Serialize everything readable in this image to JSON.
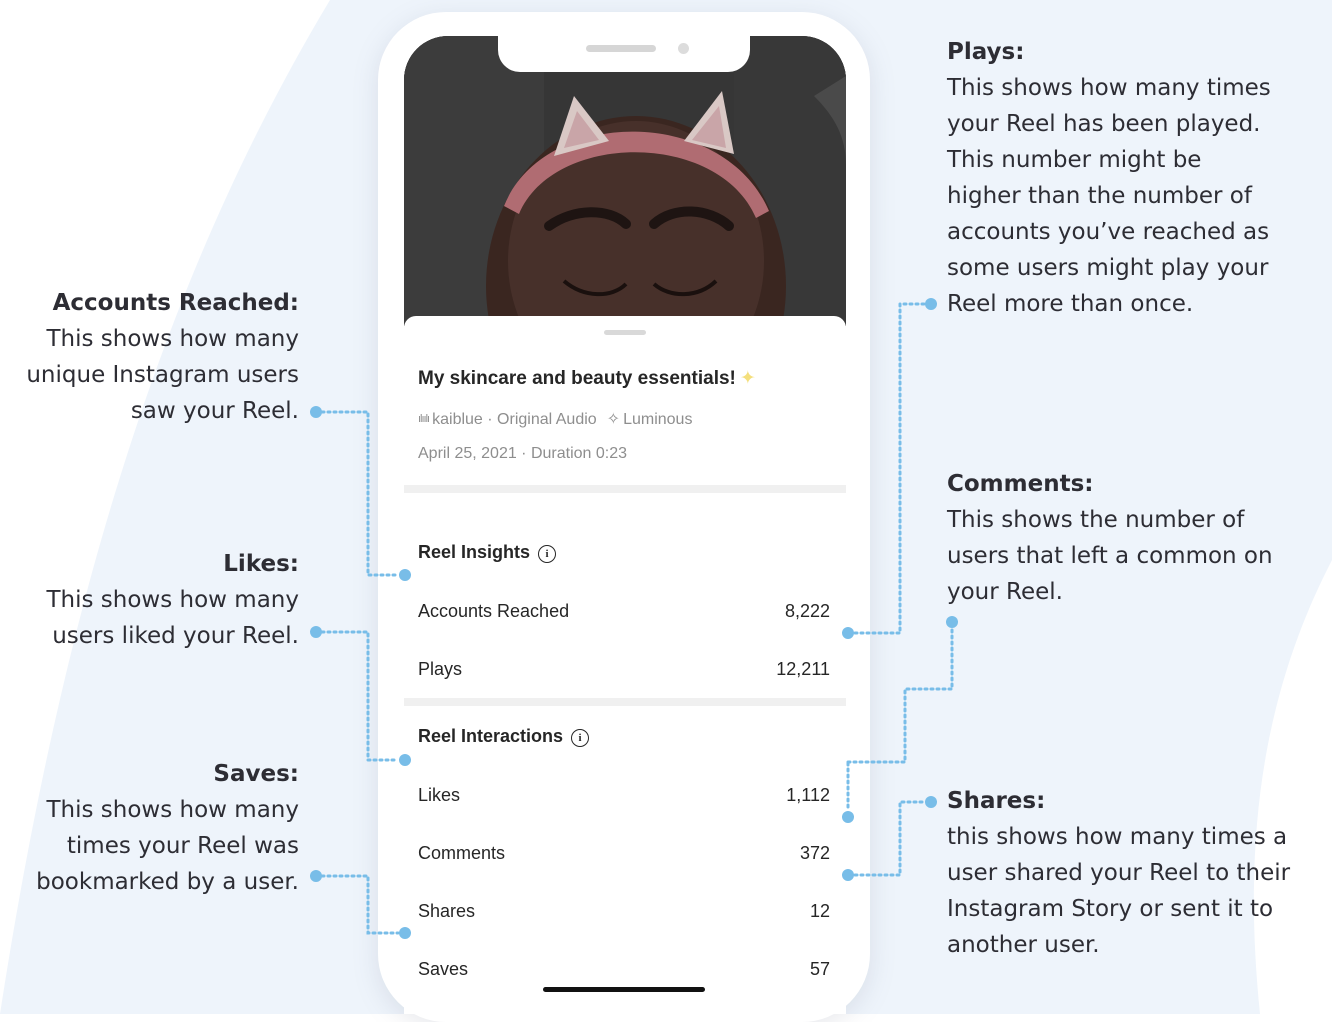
{
  "colors": {
    "accent_dot": "#78bde8",
    "annotation_text": "#2d2d34",
    "background_blob": "#eef4fb"
  },
  "reel": {
    "title": "My skincare and beauty essentials!",
    "sparkle_icon": "sparkle-icon",
    "author": "kaiblue",
    "audio": "Original Audio",
    "effect": "Luminous",
    "date_duration": "April 25, 2021 · Duration 0:23"
  },
  "insights": {
    "title": "Reel Insights",
    "rows": [
      {
        "label": "Accounts Reached",
        "value": "8,222"
      },
      {
        "label": "Plays",
        "value": "12,211"
      }
    ]
  },
  "interactions": {
    "title": "Reel Interactions",
    "rows": [
      {
        "label": "Likes",
        "value": "1,112"
      },
      {
        "label": "Comments",
        "value": "372"
      },
      {
        "label": "Shares",
        "value": "12"
      },
      {
        "label": "Saves",
        "value": "57"
      }
    ]
  },
  "annotations": {
    "accounts_reached": {
      "title": "Accounts Reached:",
      "lines": [
        "This shows how many",
        "unique Instagram users",
        "saw your Reel."
      ]
    },
    "likes": {
      "title": "Likes:",
      "lines": [
        "This shows how many",
        "users liked your Reel."
      ]
    },
    "saves": {
      "title": "Saves:",
      "lines": [
        "This shows how many",
        "times your Reel was",
        "bookmarked by a user."
      ]
    },
    "plays": {
      "title": "Plays:",
      "lines": [
        "This shows how many times",
        "your Reel has been played.",
        "This number might be",
        "higher than the number of",
        "accounts you’ve reached as",
        "some users might play your",
        "Reel more than once."
      ]
    },
    "comments": {
      "title": "Comments:",
      "lines": [
        "This shows the number of",
        "users that left a common on",
        "your Reel."
      ]
    },
    "shares": {
      "title": "Shares:",
      "lines": [
        "this shows how many times a",
        "user shared your Reel to their",
        "Instagram Story or sent it to",
        "another user."
      ]
    }
  }
}
